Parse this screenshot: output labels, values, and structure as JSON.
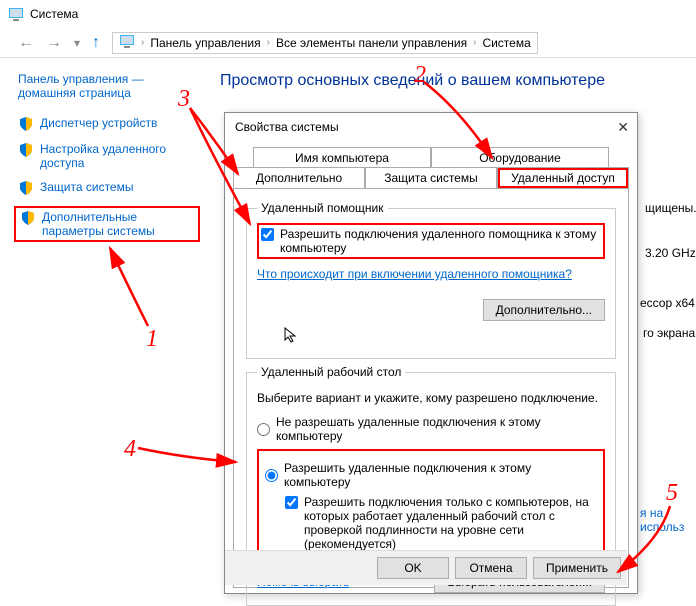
{
  "window": {
    "title": "Система"
  },
  "nav": {
    "crumbs": [
      "Панель управления",
      "Все элементы панели управления",
      "Система"
    ]
  },
  "sidebar": {
    "home": "Панель управления — домашняя страница",
    "items": [
      "Диспетчер устройств",
      "Настройка удаленного доступа",
      "Защита системы",
      "Дополнительные параметры системы"
    ]
  },
  "main": {
    "title": "Просмотр основных сведений о вашем компьютере",
    "bg_frag1": "щищены.",
    "bg_frag2": "3.20 GHz",
    "bg_frag3": "ессор x64",
    "bg_frag4": "го экрана",
    "bg_frag5": "я на использ"
  },
  "dialog": {
    "title": "Свойства системы",
    "tabs": {
      "t1": "Имя компьютера",
      "t2": "Оборудование",
      "t3": "Дополнительно",
      "t4": "Защита системы",
      "t5": "Удаленный доступ"
    },
    "ra": {
      "group": "Удаленный помощник",
      "chk": "Разрешить подключения удаленного помощника к этому компьютеру",
      "link": "Что происходит при включении удаленного помощника?",
      "adv_btn": "Дополнительно..."
    },
    "rd": {
      "group": "Удаленный рабочий стол",
      "intro": "Выберите вариант и укажите, кому разрешено подключение.",
      "r1": "Не разрешать удаленные подключения к этому компьютеру",
      "r2": "Разрешить удаленные подключения к этому компьютеру",
      "nla": "Разрешить подключения только с компьютеров, на которых работает удаленный рабочий стол с проверкой подлинности на уровне сети (рекомендуется)",
      "help": "Помочь выбрать",
      "users_btn": "Выбрать пользователей..."
    },
    "buttons": {
      "ok": "OK",
      "cancel": "Отмена",
      "apply": "Применить"
    }
  },
  "annotations": {
    "n1": "1",
    "n2": "2",
    "n3": "3",
    "n4": "4",
    "n5": "5"
  }
}
